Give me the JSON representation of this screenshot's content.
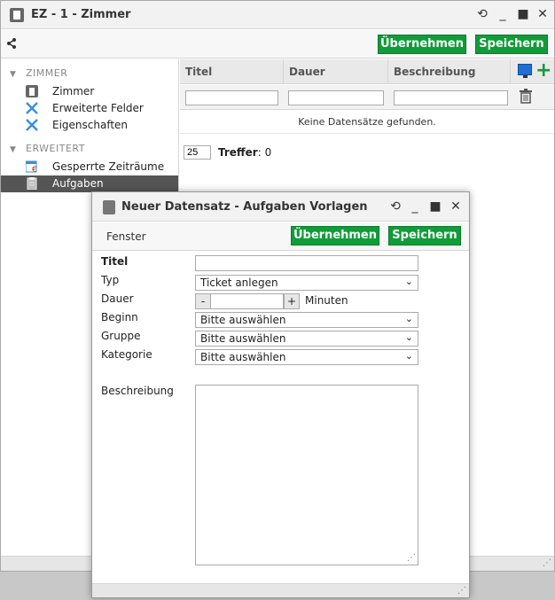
{
  "window": {
    "title": "EZ - 1 - Zimmer",
    "apply_label": "Übernehmen",
    "save_label": "Speichern"
  },
  "sidebar": {
    "sections": [
      {
        "label": "ZIMMER",
        "items": [
          {
            "label": "Zimmer",
            "icon": "room-icon"
          },
          {
            "label": "Erweiterte Felder",
            "icon": "tools-icon"
          },
          {
            "label": "Eigenschaften",
            "icon": "tools-icon"
          }
        ]
      },
      {
        "label": "ERWEITERT",
        "items": [
          {
            "label": "Gesperrte Zeiträume",
            "icon": "calendar-euro-icon"
          },
          {
            "label": "Aufgaben",
            "icon": "clipboard-icon",
            "active": true
          }
        ]
      }
    ]
  },
  "grid": {
    "columns": [
      "Titel",
      "Dauer",
      "Beschreibung"
    ],
    "empty_message": "Keine Datensätze gefunden.",
    "page_size": "25",
    "hits_label": "Treffer",
    "hits_sep": ": ",
    "hits_count": "0"
  },
  "dialog": {
    "title": "Neuer Datensatz - Aufgaben Vorlagen",
    "menu_label": "Fenster",
    "apply_label": "Übernehmen",
    "save_label": "Speichern",
    "fields": {
      "titel_label": "Titel",
      "typ_label": "Typ",
      "typ_value": "Ticket anlegen",
      "dauer_label": "Dauer",
      "dauer_minus": "-",
      "dauer_plus": "+",
      "dauer_unit": "Minuten",
      "beginn_label": "Beginn",
      "beginn_value": "Bitte auswählen",
      "gruppe_label": "Gruppe",
      "gruppe_value": "Bitte auswählen",
      "kategorie_label": "Kategorie",
      "kategorie_value": "Bitte auswählen",
      "beschreibung_label": "Beschreibung"
    }
  },
  "colors": {
    "accent_green": "#109c38",
    "sidebar_active": "#555555",
    "monitor_blue": "#1e6fd0"
  }
}
